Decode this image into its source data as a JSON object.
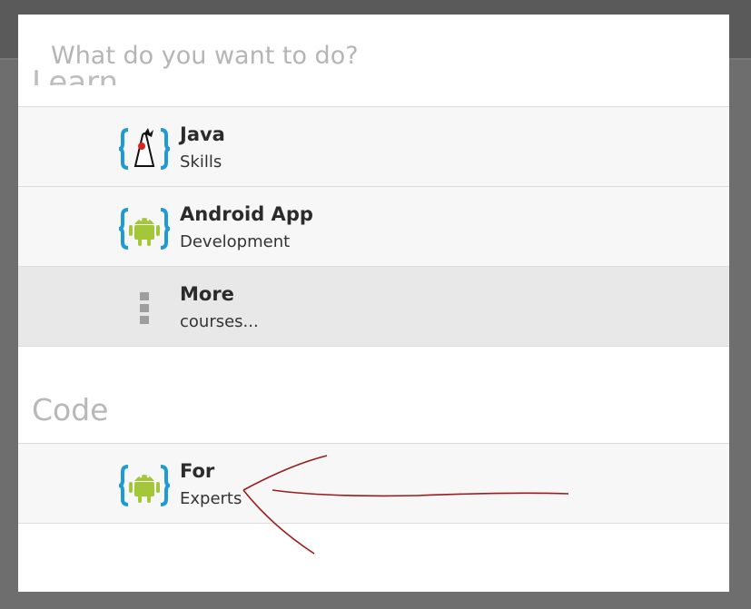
{
  "dialog": {
    "title": "What do you want to do?",
    "learn_section": "Learn",
    "code_section": "Code"
  },
  "learn_items": [
    {
      "title": "Java",
      "subtitle": "Skills",
      "icon": "java-duke-icon"
    },
    {
      "title": "Android App",
      "subtitle": "Development",
      "icon": "android-icon"
    },
    {
      "title": "More",
      "subtitle": "courses...",
      "icon": "overflow-dots-icon"
    }
  ],
  "code_items": [
    {
      "title": "For",
      "subtitle": "Experts",
      "icon": "android-icon"
    }
  ],
  "colors": {
    "brace_blue": "#1e9bd7",
    "android_green": "#a4c639",
    "annotation_red": "#9b1c1c"
  }
}
